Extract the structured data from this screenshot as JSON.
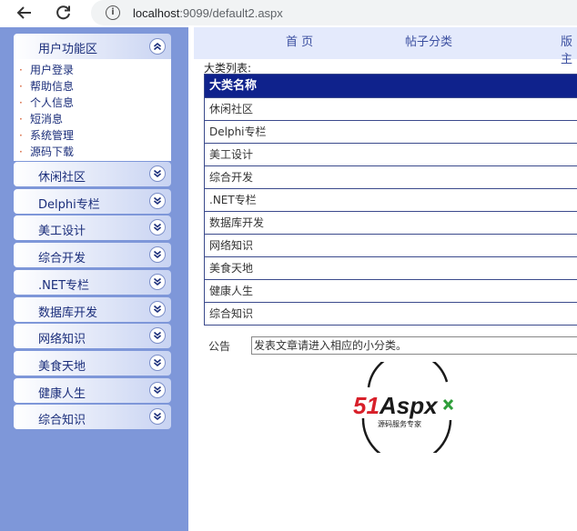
{
  "browser": {
    "url_host": "localhost",
    "url_rest": ":9099/default2.aspx"
  },
  "sidebar": {
    "panel_title": "用户功能区",
    "panel_items": [
      "用户登录",
      "帮助信息",
      "个人信息",
      "短消息",
      "系统管理",
      "源码下载"
    ],
    "categories": [
      "休闲社区",
      "Delphi专栏",
      "美工设计",
      "综合开发",
      ".NET专栏",
      "数据库开发",
      "网络知识",
      "美食天地",
      "健康人生",
      "综合知识"
    ]
  },
  "topnav": {
    "home": "首 页",
    "post_category": "帖子分类",
    "moderator": "版主"
  },
  "main": {
    "list_caption": "大类列表:",
    "table_header": "大类名称",
    "rows": [
      "休闲社区",
      "Delphi专栏",
      "美工设计",
      "综合开发",
      ".NET专栏",
      "数据库开发",
      "网络知识",
      "美食天地",
      "健康人生",
      "综合知识"
    ],
    "notice_label": "公告",
    "notice_text": "发表文章请进入相应的小分类。"
  },
  "logo": {
    "brand": "51Aspx",
    "tagline": "源码服务专家"
  },
  "colors": {
    "sidebar_bg": "#7e97d9",
    "table_header_bg": "#0f228c",
    "topnav_bg": "#e4eafc"
  }
}
